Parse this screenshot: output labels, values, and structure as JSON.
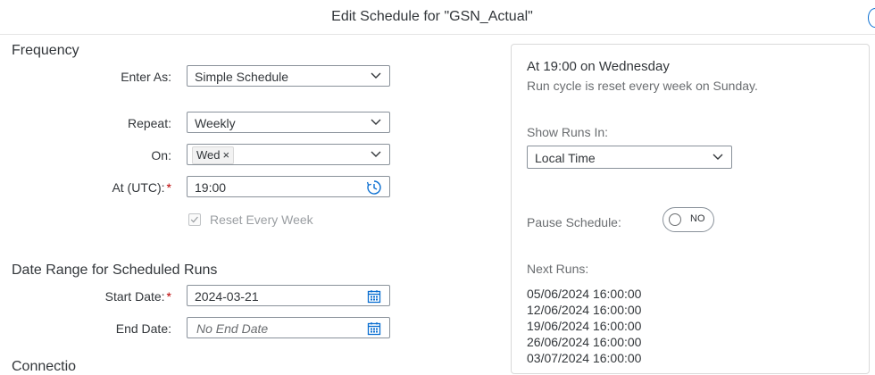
{
  "dialog": {
    "title": "Edit Schedule for \"GSN_Actual\""
  },
  "frequency": {
    "section_title": "Frequency",
    "enter_as": {
      "label": "Enter As:",
      "value": "Simple Schedule"
    },
    "repeat": {
      "label": "Repeat:",
      "value": "Weekly"
    },
    "on": {
      "label": "On:",
      "token": "Wed",
      "token_remove": "×"
    },
    "at_utc": {
      "label": "At (UTC):",
      "required_mark": "*",
      "value": "19:00"
    },
    "reset_every_week": {
      "label": "Reset Every Week",
      "checked": true,
      "disabled": true
    }
  },
  "date_range": {
    "section_title": "Date Range for Scheduled Runs",
    "start_date": {
      "label": "Start Date:",
      "required_mark": "*",
      "value": "2024-03-21"
    },
    "end_date": {
      "label": "End Date:",
      "placeholder": "No End Date"
    }
  },
  "next_section": {
    "title": "Connectio"
  },
  "summary_panel": {
    "title": "At 19:00 on Wednesday",
    "subtitle": "Run cycle is reset every week on Sunday.",
    "show_runs_in": {
      "label": "Show Runs In:",
      "value": "Local Time"
    },
    "pause_schedule": {
      "label": "Pause Schedule:",
      "toggle_text": "NO",
      "on": false
    },
    "next_runs": {
      "label": "Next Runs:",
      "items": [
        "05/06/2024 16:00:00",
        "12/06/2024 16:00:00",
        "19/06/2024 16:00:00",
        "26/06/2024 16:00:00",
        "03/07/2024 16:00:00"
      ]
    }
  },
  "icons": {
    "dropdown": "chevron-down-icon",
    "time": "time-picker-icon",
    "calendar": "calendar-icon",
    "check": "checkmark-icon"
  },
  "colors": {
    "accent": "#0a6ed1",
    "required": "#bb0000",
    "field_border": "#89919a",
    "text": "#32363a",
    "muted_text": "#6a6d70"
  }
}
